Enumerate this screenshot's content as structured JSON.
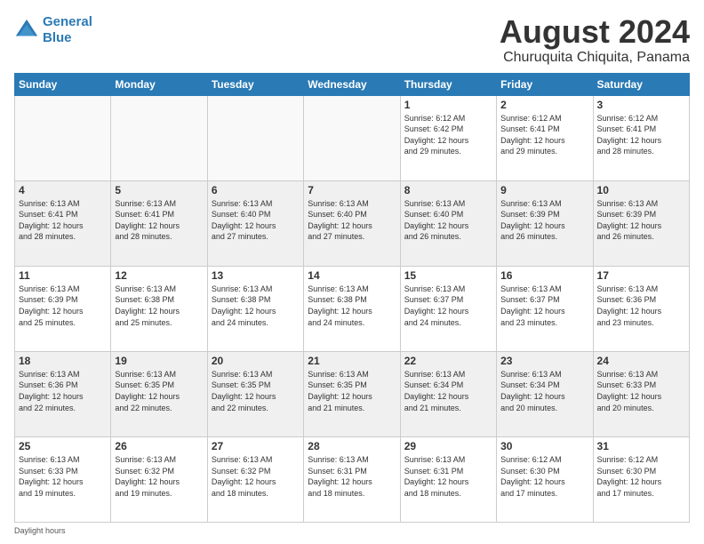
{
  "logo": {
    "line1": "General",
    "line2": "Blue"
  },
  "title": "August 2024",
  "subtitle": "Churuquita Chiquita, Panama",
  "days_of_week": [
    "Sunday",
    "Monday",
    "Tuesday",
    "Wednesday",
    "Thursday",
    "Friday",
    "Saturday"
  ],
  "footer": "Daylight hours",
  "weeks": [
    [
      {
        "day": "",
        "info": ""
      },
      {
        "day": "",
        "info": ""
      },
      {
        "day": "",
        "info": ""
      },
      {
        "day": "",
        "info": ""
      },
      {
        "day": "1",
        "info": "Sunrise: 6:12 AM\nSunset: 6:42 PM\nDaylight: 12 hours\nand 29 minutes."
      },
      {
        "day": "2",
        "info": "Sunrise: 6:12 AM\nSunset: 6:41 PM\nDaylight: 12 hours\nand 29 minutes."
      },
      {
        "day": "3",
        "info": "Sunrise: 6:12 AM\nSunset: 6:41 PM\nDaylight: 12 hours\nand 28 minutes."
      }
    ],
    [
      {
        "day": "4",
        "info": "Sunrise: 6:13 AM\nSunset: 6:41 PM\nDaylight: 12 hours\nand 28 minutes."
      },
      {
        "day": "5",
        "info": "Sunrise: 6:13 AM\nSunset: 6:41 PM\nDaylight: 12 hours\nand 28 minutes."
      },
      {
        "day": "6",
        "info": "Sunrise: 6:13 AM\nSunset: 6:40 PM\nDaylight: 12 hours\nand 27 minutes."
      },
      {
        "day": "7",
        "info": "Sunrise: 6:13 AM\nSunset: 6:40 PM\nDaylight: 12 hours\nand 27 minutes."
      },
      {
        "day": "8",
        "info": "Sunrise: 6:13 AM\nSunset: 6:40 PM\nDaylight: 12 hours\nand 26 minutes."
      },
      {
        "day": "9",
        "info": "Sunrise: 6:13 AM\nSunset: 6:39 PM\nDaylight: 12 hours\nand 26 minutes."
      },
      {
        "day": "10",
        "info": "Sunrise: 6:13 AM\nSunset: 6:39 PM\nDaylight: 12 hours\nand 26 minutes."
      }
    ],
    [
      {
        "day": "11",
        "info": "Sunrise: 6:13 AM\nSunset: 6:39 PM\nDaylight: 12 hours\nand 25 minutes."
      },
      {
        "day": "12",
        "info": "Sunrise: 6:13 AM\nSunset: 6:38 PM\nDaylight: 12 hours\nand 25 minutes."
      },
      {
        "day": "13",
        "info": "Sunrise: 6:13 AM\nSunset: 6:38 PM\nDaylight: 12 hours\nand 24 minutes."
      },
      {
        "day": "14",
        "info": "Sunrise: 6:13 AM\nSunset: 6:38 PM\nDaylight: 12 hours\nand 24 minutes."
      },
      {
        "day": "15",
        "info": "Sunrise: 6:13 AM\nSunset: 6:37 PM\nDaylight: 12 hours\nand 24 minutes."
      },
      {
        "day": "16",
        "info": "Sunrise: 6:13 AM\nSunset: 6:37 PM\nDaylight: 12 hours\nand 23 minutes."
      },
      {
        "day": "17",
        "info": "Sunrise: 6:13 AM\nSunset: 6:36 PM\nDaylight: 12 hours\nand 23 minutes."
      }
    ],
    [
      {
        "day": "18",
        "info": "Sunrise: 6:13 AM\nSunset: 6:36 PM\nDaylight: 12 hours\nand 22 minutes."
      },
      {
        "day": "19",
        "info": "Sunrise: 6:13 AM\nSunset: 6:35 PM\nDaylight: 12 hours\nand 22 minutes."
      },
      {
        "day": "20",
        "info": "Sunrise: 6:13 AM\nSunset: 6:35 PM\nDaylight: 12 hours\nand 22 minutes."
      },
      {
        "day": "21",
        "info": "Sunrise: 6:13 AM\nSunset: 6:35 PM\nDaylight: 12 hours\nand 21 minutes."
      },
      {
        "day": "22",
        "info": "Sunrise: 6:13 AM\nSunset: 6:34 PM\nDaylight: 12 hours\nand 21 minutes."
      },
      {
        "day": "23",
        "info": "Sunrise: 6:13 AM\nSunset: 6:34 PM\nDaylight: 12 hours\nand 20 minutes."
      },
      {
        "day": "24",
        "info": "Sunrise: 6:13 AM\nSunset: 6:33 PM\nDaylight: 12 hours\nand 20 minutes."
      }
    ],
    [
      {
        "day": "25",
        "info": "Sunrise: 6:13 AM\nSunset: 6:33 PM\nDaylight: 12 hours\nand 19 minutes."
      },
      {
        "day": "26",
        "info": "Sunrise: 6:13 AM\nSunset: 6:32 PM\nDaylight: 12 hours\nand 19 minutes."
      },
      {
        "day": "27",
        "info": "Sunrise: 6:13 AM\nSunset: 6:32 PM\nDaylight: 12 hours\nand 18 minutes."
      },
      {
        "day": "28",
        "info": "Sunrise: 6:13 AM\nSunset: 6:31 PM\nDaylight: 12 hours\nand 18 minutes."
      },
      {
        "day": "29",
        "info": "Sunrise: 6:13 AM\nSunset: 6:31 PM\nDaylight: 12 hours\nand 18 minutes."
      },
      {
        "day": "30",
        "info": "Sunrise: 6:12 AM\nSunset: 6:30 PM\nDaylight: 12 hours\nand 17 minutes."
      },
      {
        "day": "31",
        "info": "Sunrise: 6:12 AM\nSunset: 6:30 PM\nDaylight: 12 hours\nand 17 minutes."
      }
    ]
  ]
}
